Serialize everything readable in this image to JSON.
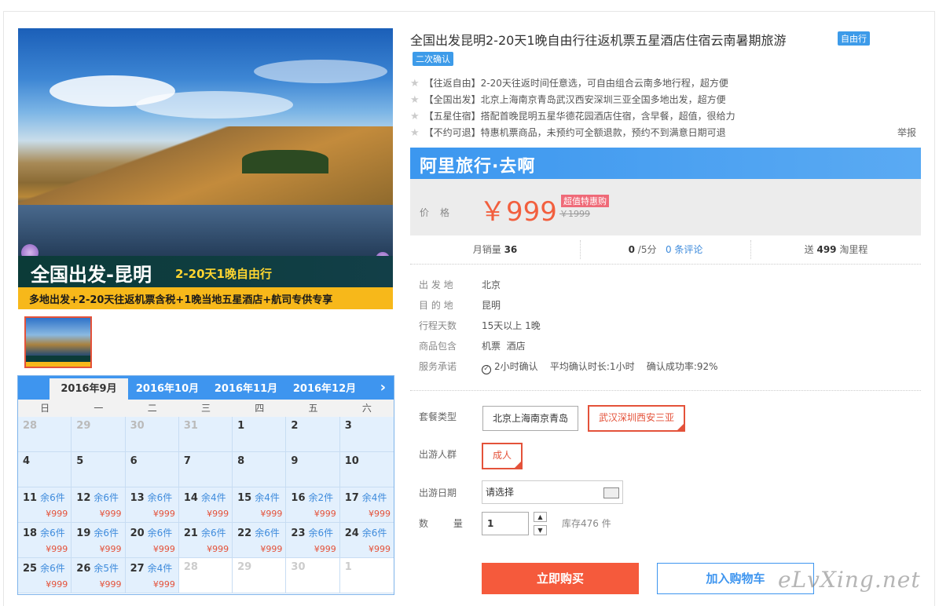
{
  "hero": {
    "banner_main": "全国出发-昆明",
    "banner_sub": "2-20天1晚自由行",
    "banner_strip": "多地出发+2-20天往返机票含税+1晚当地五星酒店+航司专供专享"
  },
  "calendar": {
    "months": [
      "2016年9月",
      "2016年10月",
      "2016年11月",
      "2016年12月"
    ],
    "active_month": "2016年9月",
    "next_icon": "chevron-right-icon",
    "weekdays": [
      "日",
      "一",
      "二",
      "三",
      "四",
      "五",
      "六"
    ],
    "days": [
      {
        "d": "28",
        "off": true
      },
      {
        "d": "29",
        "off": true
      },
      {
        "d": "30",
        "off": true
      },
      {
        "d": "31",
        "off": true
      },
      {
        "d": "1"
      },
      {
        "d": "2"
      },
      {
        "d": "3"
      },
      {
        "d": "4"
      },
      {
        "d": "5"
      },
      {
        "d": "6"
      },
      {
        "d": "7"
      },
      {
        "d": "8"
      },
      {
        "d": "9"
      },
      {
        "d": "10"
      },
      {
        "d": "11",
        "s": "余6件",
        "p": "¥999"
      },
      {
        "d": "12",
        "s": "余6件",
        "p": "¥999"
      },
      {
        "d": "13",
        "s": "余6件",
        "p": "¥999"
      },
      {
        "d": "14",
        "s": "余4件",
        "p": "¥999"
      },
      {
        "d": "15",
        "s": "余4件",
        "p": "¥999"
      },
      {
        "d": "16",
        "s": "余2件",
        "p": "¥999"
      },
      {
        "d": "17",
        "s": "余4件",
        "p": "¥999"
      },
      {
        "d": "18",
        "s": "余6件",
        "p": "¥999"
      },
      {
        "d": "19",
        "s": "余6件",
        "p": "¥999"
      },
      {
        "d": "20",
        "s": "余6件",
        "p": "¥999"
      },
      {
        "d": "21",
        "s": "余6件",
        "p": "¥999"
      },
      {
        "d": "22",
        "s": "余6件",
        "p": "¥999"
      },
      {
        "d": "23",
        "s": "余6件",
        "p": "¥999"
      },
      {
        "d": "24",
        "s": "余6件",
        "p": "¥999"
      },
      {
        "d": "25",
        "s": "余6件",
        "p": "¥999"
      },
      {
        "d": "26",
        "s": "余5件",
        "p": "¥999"
      },
      {
        "d": "27",
        "s": "余4件",
        "p": "¥999"
      },
      {
        "d": "28",
        "past": true
      },
      {
        "d": "29",
        "past": true
      },
      {
        "d": "30",
        "past": true
      },
      {
        "d": "1",
        "past": true
      }
    ]
  },
  "product": {
    "title": "全国出发昆明2-20天1晚自由行往返机票五星酒店住宿云南暑期旅游",
    "tag_self": "自由行",
    "tag_confirm": "二次确认",
    "features": [
      "【往返自由】2-20天往返时间任意选，可自由组合云南多地行程，超方便",
      "【全国出发】北京上海南京青岛武汉西安深圳三亚全国多地出发，超方便",
      "【五星住宿】搭配首晚昆明五星华德花园酒店住宿，含早餐，超值，很给力",
      "【不约可退】特惠机票商品，未预约可全额退款，预约不到满意日期可退"
    ],
    "report": "举报"
  },
  "price": {
    "brand": "阿里旅行·去啊",
    "label": "价格",
    "value": "￥999",
    "badge": "超值特惠购",
    "old": "￥1999"
  },
  "stats": {
    "sales_label": "月销量",
    "sales": "36",
    "rating": "0",
    "rating_unit": "/5分",
    "reviews": "0 条评论",
    "points_pre": "送",
    "points": "499",
    "points_post": "淘里程"
  },
  "info": [
    {
      "k": "出 发 地",
      "v": "北京"
    },
    {
      "k": "目 的 地",
      "v": "昆明"
    },
    {
      "k": "行程天数",
      "v": "15天以上 1晚"
    },
    {
      "k": "商品包含",
      "v": "机票  酒店"
    },
    {
      "k": "服务承诺",
      "v": "2小时确认    平均确认时长:1小时    确认成功率:92%"
    }
  ],
  "options": {
    "package_label": "套餐类型",
    "package_a": "北京上海南京青岛",
    "package_b": "武汉深圳西安三亚",
    "people_label": "出游人群",
    "people": "成人",
    "date_label": "出游日期",
    "date_value": "请选择",
    "qty_label": "数 量",
    "qty_value": "1",
    "stock": "库存476 件"
  },
  "actions": {
    "buy": "立即购买",
    "cart": "加入购物车"
  },
  "watermark": "eLvXing.net"
}
